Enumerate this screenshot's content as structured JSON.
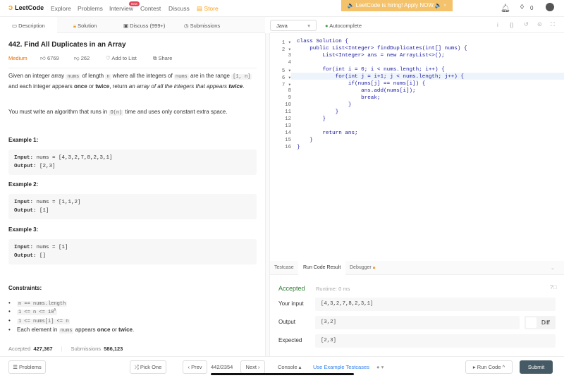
{
  "nav": {
    "logo": "LeetCode",
    "items": [
      "Explore",
      "Problems",
      "Interview",
      "Contest",
      "Discuss",
      "Store"
    ],
    "new_badge": "New",
    "banner": "🔈 LeetCode is hiring! Apply NOW.🔈",
    "banner_close": "×",
    "points": "0",
    "accent": "#ffa116"
  },
  "tabs": [
    "Description",
    "Solution",
    "Discuss (999+)",
    "Submissions"
  ],
  "problem": {
    "title": "442. Find All Duplicates in an Array",
    "difficulty": "Medium",
    "likes": "6769",
    "dislikes": "262",
    "add_to_list": "Add to List",
    "share": "Share",
    "desc1_a": "Given an integer array ",
    "desc1_code1": "nums",
    "desc1_b": " of length ",
    "desc1_code2": "n",
    "desc1_c": " where all the integers of ",
    "desc1_code3": "nums",
    "desc1_d": " are in the range ",
    "desc1_code4": "[1, n]",
    "desc1_e": " and each integer appears ",
    "once": "once",
    "or": " or ",
    "twice": "twice",
    "desc1_f": ", return ",
    "desc1_g": "an array of all the integers that appears ",
    "desc1_h": ".",
    "desc2_a": "You must write an algorithm that runs in ",
    "desc2_code": "O(n)",
    "desc2_b": " time and uses only constant extra space.",
    "examples": [
      {
        "label": "Example 1:",
        "input_label": "Input:",
        "input": " nums = [4,3,2,7,8,2,3,1]",
        "output_label": "Output:",
        "output": " [2,3]"
      },
      {
        "label": "Example 2:",
        "input_label": "Input:",
        "input": " nums = [1,1,2]",
        "output_label": "Output:",
        "output": " [1]"
      },
      {
        "label": "Example 3:",
        "input_label": "Input:",
        "input": " nums = [1]",
        "output_label": "Output:",
        "output": " []"
      }
    ],
    "constraints_label": "Constraints:",
    "constraints": [
      "n == nums.length",
      "1 <= n <= 10",
      "1 <= nums[i] <= n"
    ],
    "exp": "5",
    "c4_a": "Each element in ",
    "c4_code": "nums",
    "c4_b": " appears ",
    "c4_c": ".",
    "accepted_label": "Accepted",
    "accepted": "427,367",
    "submissions_label": "Submissions",
    "submissions": "586,123"
  },
  "editor": {
    "language": "Java",
    "autocomplete": "Autocomplete",
    "lines": [
      "class Solution {",
      "    public List<Integer> findDuplicates(int[] nums) {",
      "        List<Integer> ans = new ArrayList<>();",
      "",
      "        for(int i = 0; i < nums.length; i++) {",
      "            for(int j = i+1; j < nums.length; j++) {",
      "                if(nums[j] == nums[i]) {",
      "                    ans.add(nums[i]);",
      "                    break;",
      "                }",
      "            }",
      "        }",
      "",
      "        return ans;",
      "    }",
      "}"
    ],
    "line_numbers": [
      "1 ▾",
      "2 ▾",
      "3",
      "4",
      "5 ▾",
      "6 ▾",
      "7 ▾",
      "8",
      "9",
      "10",
      "11",
      "12",
      "13",
      "14",
      "15",
      "16"
    ]
  },
  "result": {
    "tabs": [
      "Testcase",
      "Run Code Result",
      "Debugger"
    ],
    "status": "Accepted",
    "runtime": "Runtime: 0 ms",
    "your_input_label": "Your input",
    "your_input": "[4,3,2,7,8,2,3,1]",
    "output_label": "Output",
    "output": "[3,2]",
    "diff": "Diff",
    "expected_label": "Expected",
    "expected": "[2,3]"
  },
  "bottom": {
    "problems": "☰ Problems",
    "pick_one": "⤮ Pick One",
    "prev": "‹ Prev",
    "page": "442/2354",
    "next": "Next ›",
    "console": "Console",
    "use_example": "Use Example Testcases",
    "run_code": "▸ Run Code ^",
    "submit": "Submit"
  }
}
